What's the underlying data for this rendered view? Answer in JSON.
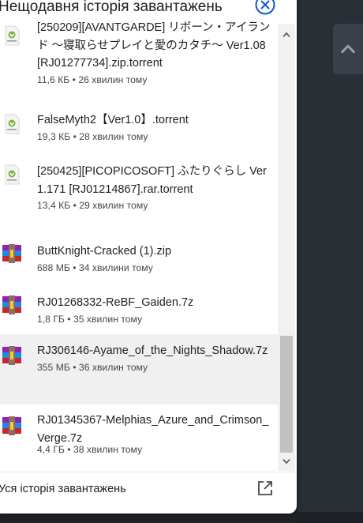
{
  "header": {
    "title": "Нещодавня історія завантажень"
  },
  "items": [
    {
      "icon": "torrent-file-icon",
      "name": "[250209][AVANTGARDE] リボーン・アイランド 〜寝取らせプレイと愛のカタチ〜 Ver1.08 [RJ01277734].zip.torrent",
      "meta": "11,6 КБ • 26 хвилин тому"
    },
    {
      "icon": "torrent-file-icon",
      "name": "FalseMyth2【Ver1.0】.torrent",
      "meta": "19,3 КБ • 28 хвилин тому"
    },
    {
      "icon": "torrent-file-icon",
      "name": "[250425][PICOPICOSOFT] ふたりぐらし Ver1.171 [RJ01214867].rar.torrent",
      "meta": "13,4 КБ • 29 хвилин тому"
    },
    {
      "icon": "winrar-archive-icon",
      "name": "ButtKnight-Cracked (1).zip",
      "meta": "688 МБ • 34 хвилини тому"
    },
    {
      "icon": "winrar-archive-icon",
      "name": "RJ01268332-ReBF_Gaiden.7z",
      "meta": "1,8 ГБ • 35 хвилин тому"
    },
    {
      "icon": "winrar-archive-icon",
      "name": "RJ306146-Ayame_of_the_Nights_Shadow.7z",
      "meta": "355 МБ • 36 хвилин тому"
    },
    {
      "icon": "winrar-archive-icon",
      "name": "RJ01345367-Melphias_Azure_and_Crimson_Verge.7z",
      "meta": "4,4 ГБ • 38 хвилин тому"
    }
  ],
  "footer": {
    "label": "Уся історія завантажень"
  }
}
